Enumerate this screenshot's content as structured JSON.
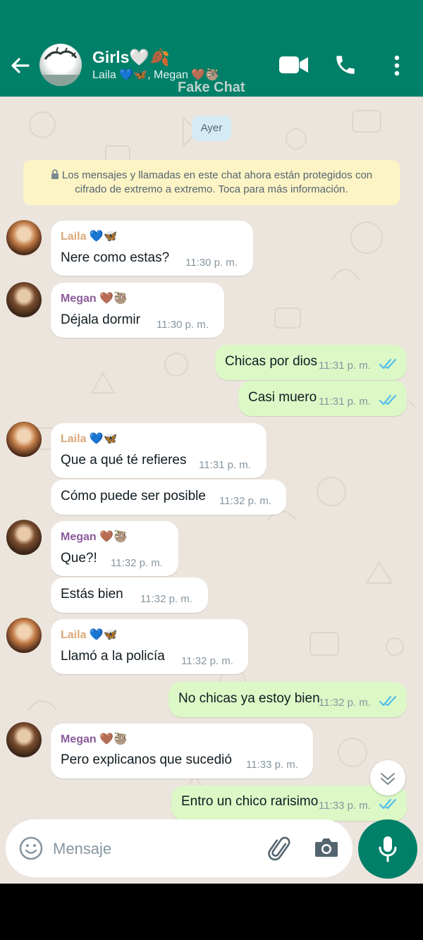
{
  "header": {
    "title": "Girls🤍🍂",
    "subtitle": "Laila 💙🦋, Megan 🤎🦥",
    "watermark": "Fake Chat",
    "icons": [
      "back-arrow-icon",
      "video-call-icon",
      "voice-call-icon",
      "more-options-icon"
    ],
    "bg_color": "#008069"
  },
  "date_chip": "Ayer",
  "encryption_notice": "Los mensajes y llamadas en este chat ahora están protegidos con cifrado de extremo a extremo. Toca para más información.",
  "messages": [
    {
      "sender": "Laila",
      "sender_emoji": "💙🦋",
      "text": "Nere como estas?",
      "time": "11:30 p. m."
    },
    {
      "sender": "Megan",
      "sender_emoji": "🤎🦥",
      "text": "Déjala dormir",
      "time": "11:30 p. m."
    },
    {
      "text": "Chicas por dios",
      "time": "11:31 p. m."
    },
    {
      "text": "Casi muero",
      "time": "11:31 p. m."
    },
    {
      "sender": "Laila",
      "sender_emoji": "💙🦋",
      "text": "Que a qué té refieres",
      "time": "11:31 p. m."
    },
    {
      "text": "Cómo puede ser posible",
      "time": "11:32 p. m."
    },
    {
      "sender": "Megan",
      "sender_emoji": "🤎🦥",
      "text": "Que?!",
      "time": "11:32 p. m."
    },
    {
      "text": "Estás bien",
      "time": "11:32 p. m."
    },
    {
      "sender": "Laila",
      "sender_emoji": "💙🦋",
      "text": "Llamó a la policía",
      "time": "11:32 p. m."
    },
    {
      "text": "No chicas ya estoy bien",
      "time": "11:32 p. m."
    },
    {
      "sender": "Megan",
      "sender_emoji": "🤎🦥",
      "text": "Pero explicanos que sucedió",
      "time": "11:33 p. m."
    },
    {
      "text": "Entro un chico rarisimo",
      "time": "11:33 p. m."
    }
  ],
  "composer": {
    "placeholder": "Mensaje",
    "icons": [
      "emoji-icon",
      "attach-icon",
      "camera-icon",
      "mic-icon"
    ]
  },
  "colors": {
    "incoming_bubble": "#ffffff",
    "outgoing_bubble": "#dcf8c6",
    "read_ticks": "#53bdeb",
    "laila_name": "#d9a87a",
    "megan_name": "#8a5a9a"
  }
}
